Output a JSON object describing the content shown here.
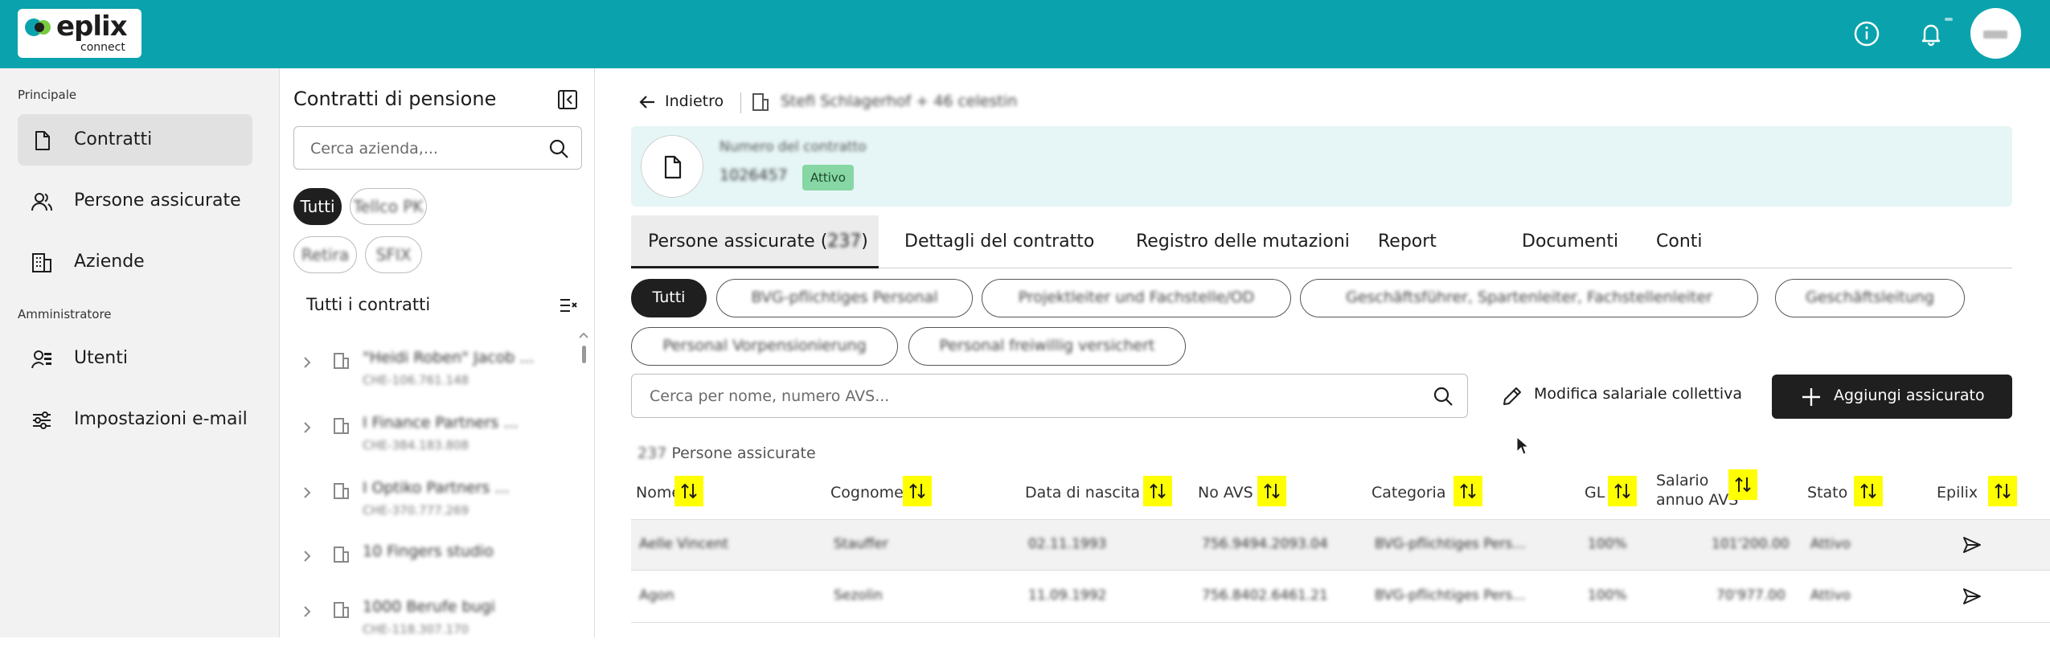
{
  "app": {
    "logo_word": "eplix",
    "logo_sub": "connect",
    "brand_color": "#0aa3ad",
    "accent_dark": "#1f1f1f",
    "status_active_color": "#86d7a4"
  },
  "topbar": {
    "icons": [
      "info-icon",
      "bell-icon",
      "avatar"
    ]
  },
  "sidebar": {
    "section_main": "Principale",
    "section_admin": "Amministratore",
    "items": [
      {
        "label": "Contratti",
        "icon": "document-icon",
        "active": true
      },
      {
        "label": "Persone assicurate",
        "icon": "people-icon"
      },
      {
        "label": "Aziende",
        "icon": "building-icon"
      },
      {
        "label": "Utenti",
        "icon": "users-admin-icon"
      },
      {
        "label": "Impostazioni e-mail",
        "icon": "sliders-icon"
      }
    ]
  },
  "contracts_panel": {
    "title": "Contratti di pensione",
    "search_placeholder": "Cerca azienda,...",
    "chips": [
      "Tutti",
      "Tellco PK",
      "Retira",
      "SFIX"
    ],
    "list_title": "Tutti i contratti",
    "items": [
      {
        "name": "\"Heidi Roben\" Jacob ...",
        "sub": "CHE-106.761.148"
      },
      {
        "name": "I Finance Partners ...",
        "sub": "CHE-384.183.808"
      },
      {
        "name": "I Optiko Partners ...",
        "sub": "CHE-370.777.269"
      },
      {
        "name": "10 Fingers studio",
        "sub": ""
      },
      {
        "name": "1000 Berufe bugi",
        "sub": "CHE-118.307.170"
      }
    ]
  },
  "main": {
    "back_label": "Indietro",
    "breadcrumb_text": "Stefi Schlagerhof + 46 celestin",
    "card": {
      "label": "Numero del contratto",
      "number": "1026457",
      "status": "Attivo"
    },
    "tabs": [
      {
        "label": "Persone assicurate (",
        "count": "237",
        "suffix": ")"
      },
      {
        "label": "Dettagli del contratto"
      },
      {
        "label": "Registro delle mutazioni"
      },
      {
        "label": "Report"
      },
      {
        "label": "Documenti"
      },
      {
        "label": "Conti"
      }
    ],
    "filters": [
      "Tutti",
      "BVG-pflichtiges Personal",
      "Projektleiter und Fachstelle/OD",
      "Geschäftsführer, Spartenleiter, Fachstellenleiter",
      "Geschäftsleitung",
      "Personal Vorpensionierung",
      "Personal freiwillig versichert"
    ],
    "search_placeholder": "Cerca per nome, numero AVS...",
    "edit_label": "Modifica salariale collettiva",
    "add_label": "Aggiungi assicurato",
    "count": "237",
    "count_suffix": "Persone assicurate",
    "columns": [
      "Nome",
      "Cognome",
      "Data di nascita",
      "No AVS",
      "Categoria",
      "GL",
      "Salario",
      "annuo AVS",
      "Stato",
      "Epilix"
    ],
    "rows": [
      [
        "Aelle Vincent",
        "Stauffer",
        "02.11.1993",
        "756.9494.2093.04",
        "BVG-pflichtiges Pers...",
        "100%",
        "101'200.00",
        "Attivo"
      ],
      [
        "Agon",
        "Sezolin",
        "11.09.1992",
        "756.8402.6461.21",
        "BVG-pflichtiges Pers...",
        "100%",
        "70'977.00",
        "Attivo"
      ]
    ]
  }
}
